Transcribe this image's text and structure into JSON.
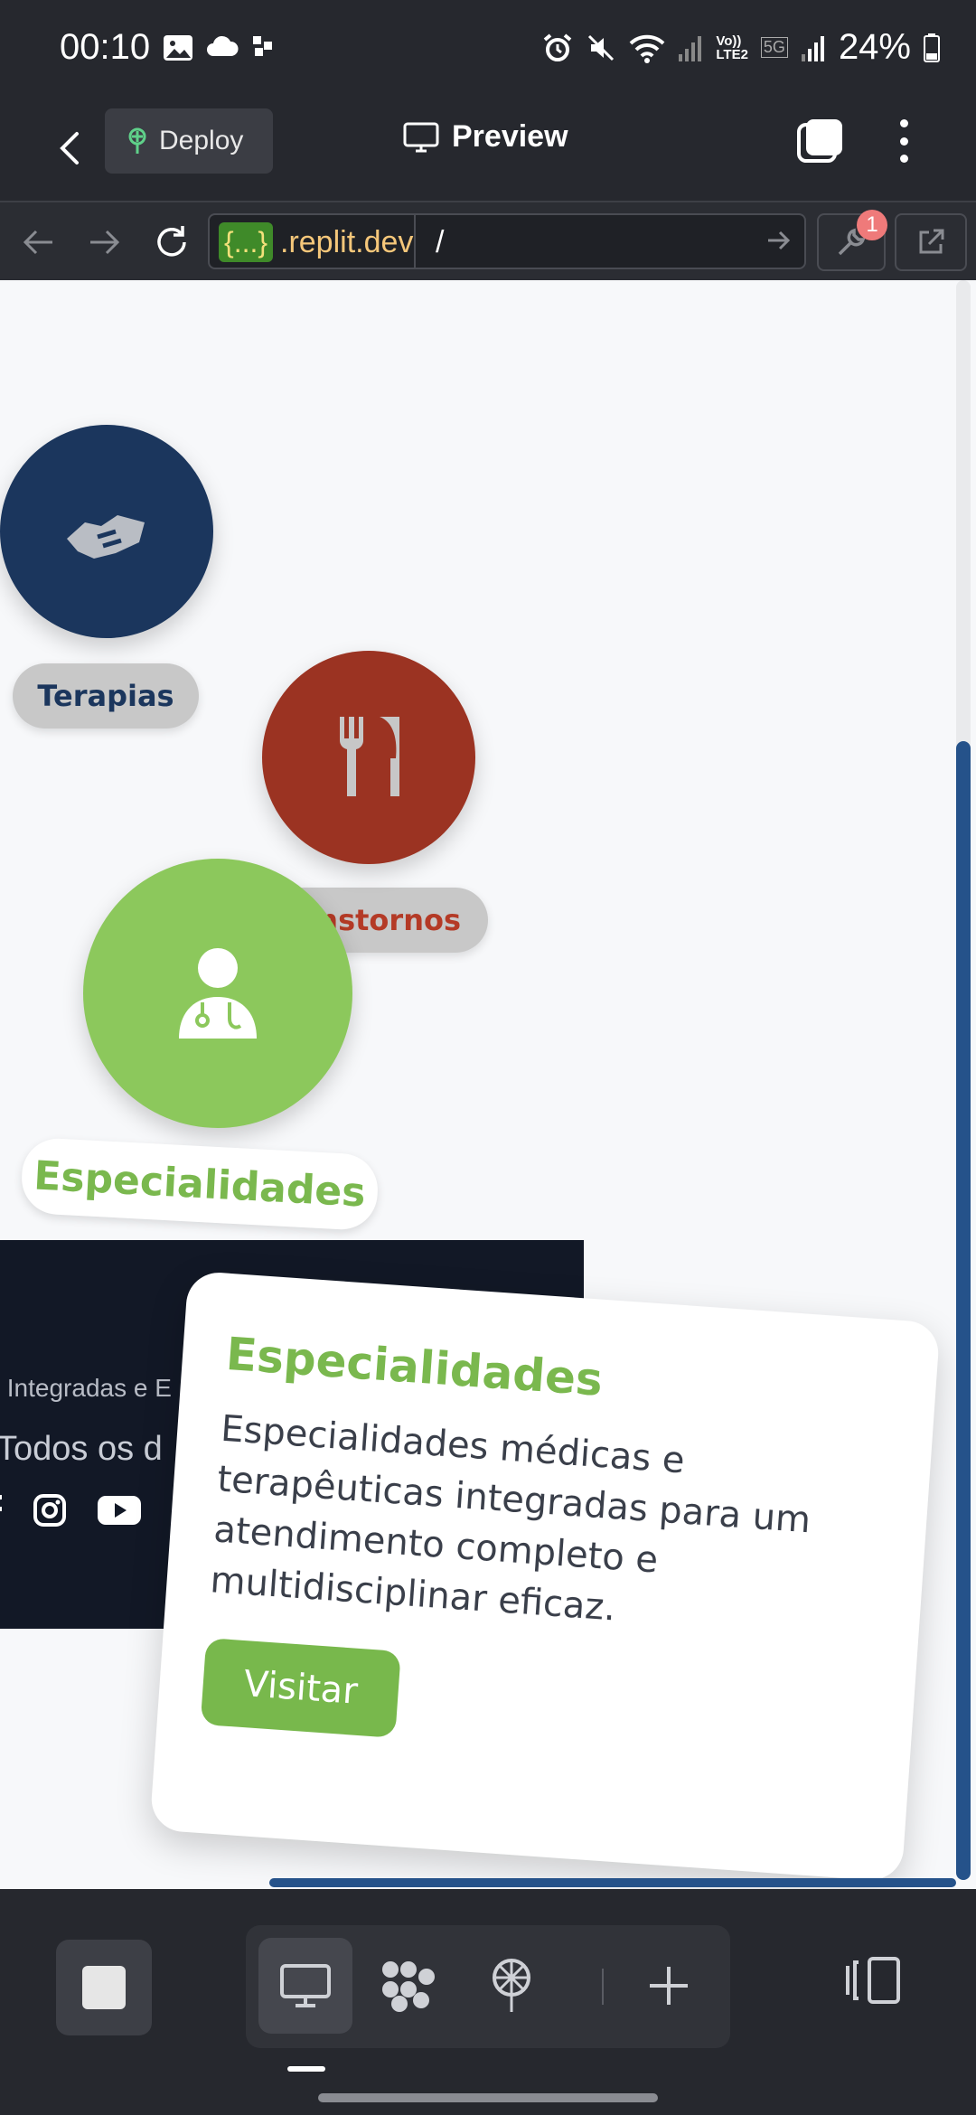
{
  "status_bar": {
    "time": "00:10",
    "battery_percent": "24%",
    "network_label": "LTE2",
    "network_5g": "5G"
  },
  "app_bar": {
    "deploy_label": "Deploy",
    "title": "Preview"
  },
  "url_bar": {
    "host_prefix": "{...}",
    "host": ".replit.dev",
    "path": "/",
    "devtools_badge": "1"
  },
  "page": {
    "circles": [
      {
        "label": "Terapias",
        "color": "#1b365d",
        "label_color": "#1b365d",
        "icon": "handshake-icon"
      },
      {
        "label": "Transtornos",
        "color": "#9b3322",
        "label_color": "#b43a26",
        "icon": "utensils-icon"
      },
      {
        "label": "Especialidades",
        "color": "#8cc85c",
        "label_color": "#7ab84e",
        "icon": "doctor-icon"
      }
    ],
    "footer": {
      "line1": "s Integradas e E",
      "line2": "Todos os d"
    },
    "card": {
      "title": "Especialidades",
      "text": "Especialidades médicas e terapêuticas integradas para um atendimento completo e multidisciplinar eficaz.",
      "button": "Visitar"
    }
  },
  "bottom_bar": {
    "tools": [
      "preview-icon",
      "workspace-icon",
      "deploy-icon",
      "add-icon"
    ]
  }
}
